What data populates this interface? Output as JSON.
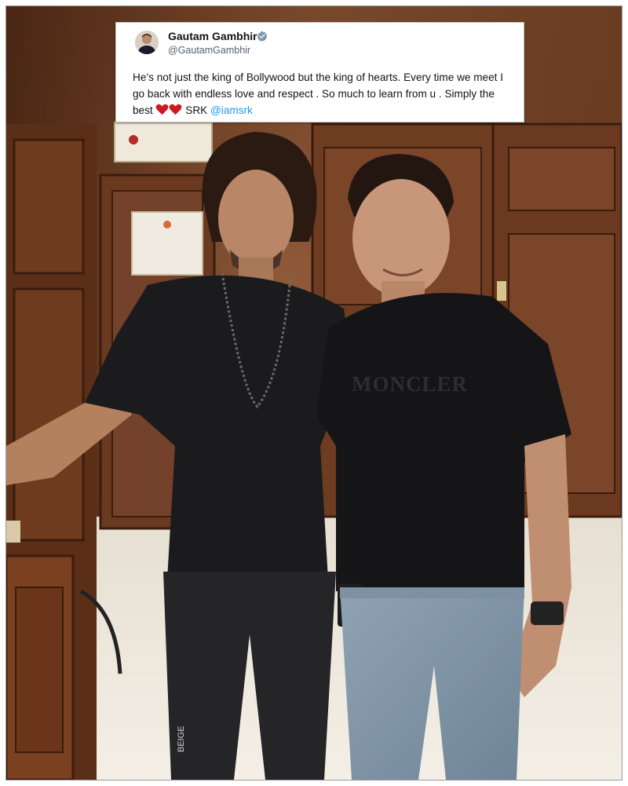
{
  "tweet": {
    "display_name": "Gautam Gambhir",
    "handle": "@GautamGambhir",
    "verified_icon": "verified-badge-icon",
    "text_part1": "He’s not just the king of Bollywood but the king of hearts. Every time we meet I go back with endless love and respect . So much to learn from u . Simply the best",
    "text_part2": " SRK ",
    "mention": "@iamsrk",
    "heart_icons": [
      "red-heart-icon",
      "red-heart-icon"
    ],
    "mention_color": "#1d9bf0"
  },
  "photo": {
    "shirt_print": "MONCLER",
    "pants_print": "BEIGE"
  }
}
